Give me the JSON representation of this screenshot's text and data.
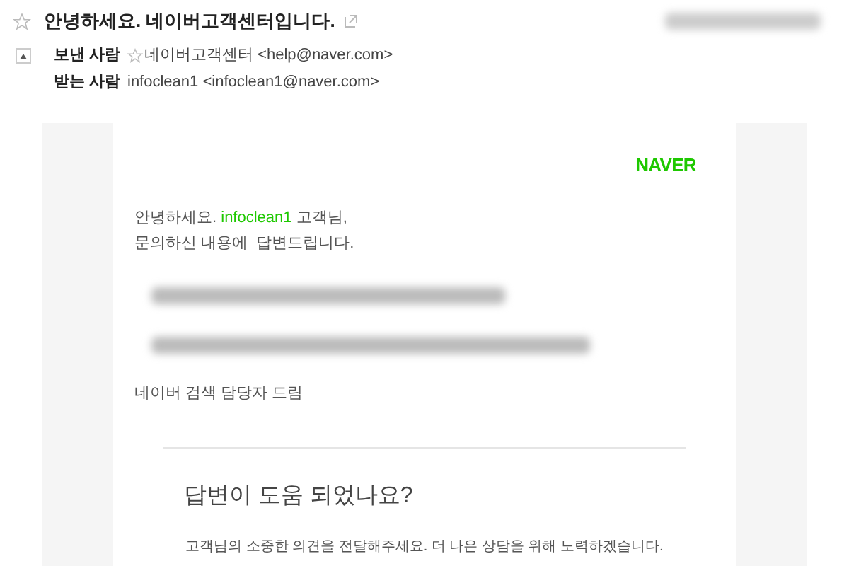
{
  "mail": {
    "subject": "안녕하세요. 네이버고객센터입니다.",
    "from_label": "보낸 사람",
    "from": "네이버고객센터 <help@naver.com>",
    "to_label": "받는 사람",
    "to": "infoclean1 <infoclean1@naver.com>"
  },
  "body": {
    "logo": "NAVER",
    "greeting": {
      "before": "안녕하세요.",
      "name": "infoclean1",
      "after": "고객님,"
    },
    "intro": "문의하신 내용에  답변드립니다.",
    "signature": "네이버 검색 담당자 드림",
    "feedback_title": "답변이 도움 되었나요?",
    "feedback_text": "고객님의 소중한 의견을 전달해주세요. 더 나은 상담을 위해 노력하겠습니다."
  }
}
